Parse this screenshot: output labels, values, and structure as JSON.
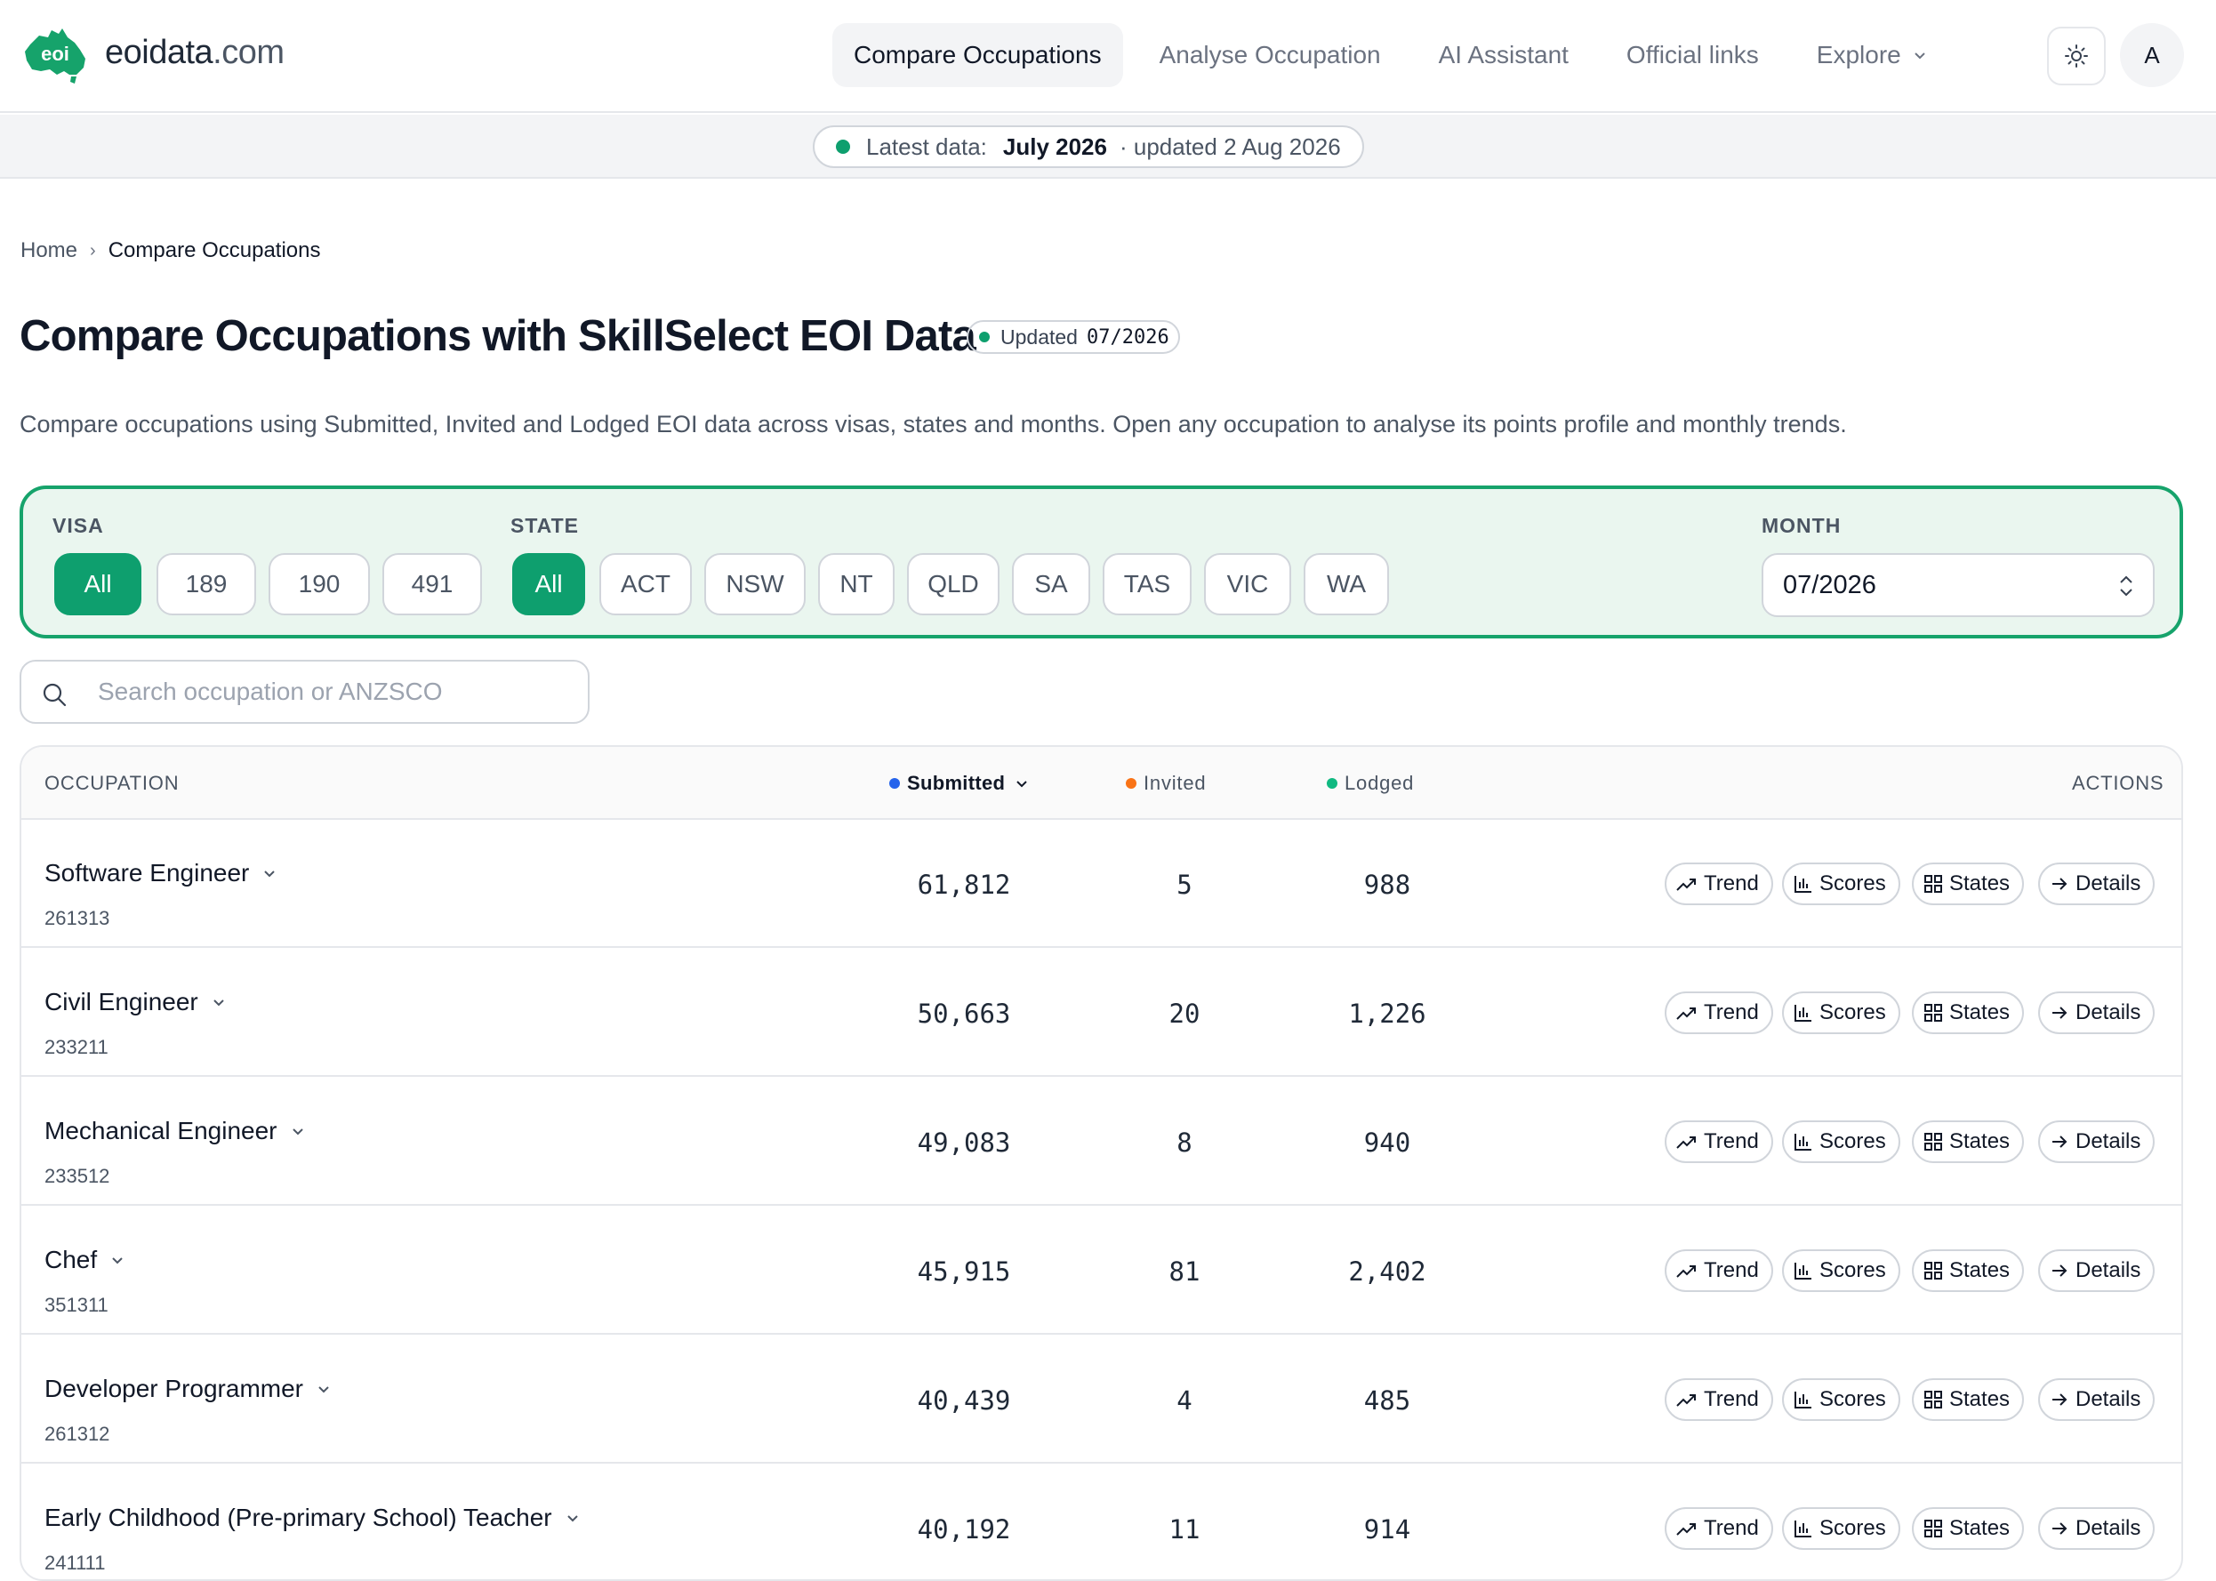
{
  "brand": {
    "name": "eoidata",
    "domain": ".com",
    "logo_text": "eoi",
    "accent": "#16a36b"
  },
  "nav": {
    "links": [
      {
        "label": "Compare Occupations",
        "active": true
      },
      {
        "label": "Analyse Occupation",
        "active": false
      },
      {
        "label": "AI Assistant",
        "active": false
      },
      {
        "label": "Official links",
        "active": false
      },
      {
        "label": "Explore",
        "active": false
      }
    ],
    "theme_icon": "sun-icon",
    "avatar": "A"
  },
  "status": {
    "label": "Latest data:",
    "month": "July 2026",
    "updated": "· updated 2 Aug 2026"
  },
  "breadcrumb": {
    "home": "Home",
    "sep": "›",
    "current": "Compare Occupations"
  },
  "page": {
    "title": "Compare Occupations with SkillSelect EOI Data",
    "badge_label": "Updated",
    "badge_value": "07/2026",
    "intro": "Compare occupations using Submitted, Invited and Lodged EOI data across visas, states and months. Open any occupation to analyse its points profile and monthly trends."
  },
  "filters": {
    "visa_label": "VISA",
    "visa_options": [
      "All",
      "189",
      "190",
      "491"
    ],
    "visa_selected": "All",
    "state_label": "STATE",
    "state_options": [
      "All",
      "ACT",
      "NSW",
      "NT",
      "QLD",
      "SA",
      "TAS",
      "VIC",
      "WA"
    ],
    "state_selected": "All",
    "month_label": "MONTH",
    "month_value": "07/2026"
  },
  "search": {
    "placeholder": "Search occupation or ANZSCO",
    "value": ""
  },
  "table": {
    "headers": {
      "occupation": "OCCUPATION",
      "submitted": "Submitted",
      "invited": "Invited",
      "lodged": "Lodged",
      "actions": "ACTIONS"
    },
    "colors": {
      "submitted": "#2563eb",
      "invited": "#f97316",
      "lodged": "#10b981"
    },
    "sorted_by": "submitted",
    "actions": [
      "Trend",
      "Scores",
      "States",
      "Details"
    ],
    "rows": [
      {
        "name": "Software Engineer",
        "code": "261313",
        "submitted": "61,812",
        "invited": "5",
        "lodged": "988"
      },
      {
        "name": "Civil Engineer",
        "code": "233211",
        "submitted": "50,663",
        "invited": "20",
        "lodged": "1,226"
      },
      {
        "name": "Mechanical Engineer",
        "code": "233512",
        "submitted": "49,083",
        "invited": "8",
        "lodged": "940"
      },
      {
        "name": "Chef",
        "code": "351311",
        "submitted": "45,915",
        "invited": "81",
        "lodged": "2,402"
      },
      {
        "name": "Developer Programmer",
        "code": "261312",
        "submitted": "40,439",
        "invited": "4",
        "lodged": "485"
      },
      {
        "name": "Early Childhood (Pre-primary School) Teacher",
        "code": "241111",
        "submitted": "40,192",
        "invited": "11",
        "lodged": "914"
      }
    ]
  }
}
